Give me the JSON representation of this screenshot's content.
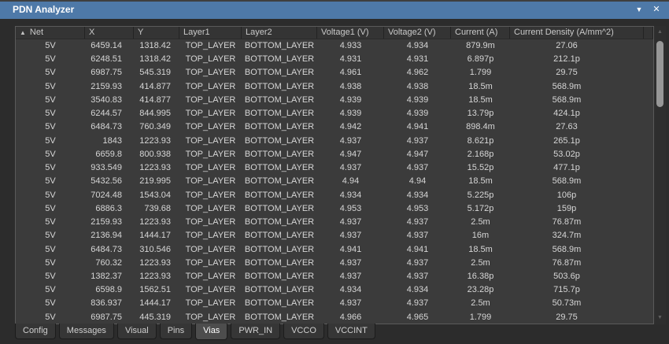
{
  "window": {
    "title": "PDN Analyzer"
  },
  "titlebar": {
    "menu_icon": "▼",
    "close_icon": "✕"
  },
  "table": {
    "sort_icon": "▲",
    "columns": [
      "Net",
      "X",
      "Y",
      "Layer1",
      "Layer2",
      "Voltage1 (V)",
      "Voltage2 (V)",
      "Current (A)",
      "Current Density (A/mm^2)"
    ],
    "rows": [
      [
        "5V",
        "6459.14",
        "1318.42",
        "TOP_LAYER",
        "BOTTOM_LAYER",
        "4.933",
        "4.934",
        "879.9m",
        "27.06"
      ],
      [
        "5V",
        "6248.51",
        "1318.42",
        "TOP_LAYER",
        "BOTTOM_LAYER",
        "4.931",
        "4.931",
        "6.897p",
        "212.1p"
      ],
      [
        "5V",
        "6987.75",
        "545.319",
        "TOP_LAYER",
        "BOTTOM_LAYER",
        "4.961",
        "4.962",
        "1.799",
        "29.75"
      ],
      [
        "5V",
        "2159.93",
        "414.877",
        "TOP_LAYER",
        "BOTTOM_LAYER",
        "4.938",
        "4.938",
        "18.5m",
        "568.9m"
      ],
      [
        "5V",
        "3540.83",
        "414.877",
        "TOP_LAYER",
        "BOTTOM_LAYER",
        "4.939",
        "4.939",
        "18.5m",
        "568.9m"
      ],
      [
        "5V",
        "6244.57",
        "844.995",
        "TOP_LAYER",
        "BOTTOM_LAYER",
        "4.939",
        "4.939",
        "13.79p",
        "424.1p"
      ],
      [
        "5V",
        "6484.73",
        "760.349",
        "TOP_LAYER",
        "BOTTOM_LAYER",
        "4.942",
        "4.941",
        "898.4m",
        "27.63"
      ],
      [
        "5V",
        "1843",
        "1223.93",
        "TOP_LAYER",
        "BOTTOM_LAYER",
        "4.937",
        "4.937",
        "8.621p",
        "265.1p"
      ],
      [
        "5V",
        "6659.8",
        "800.938",
        "TOP_LAYER",
        "BOTTOM_LAYER",
        "4.947",
        "4.947",
        "2.168p",
        "53.02p"
      ],
      [
        "5V",
        "933.549",
        "1223.93",
        "TOP_LAYER",
        "BOTTOM_LAYER",
        "4.937",
        "4.937",
        "15.52p",
        "477.1p"
      ],
      [
        "5V",
        "5432.56",
        "219.995",
        "TOP_LAYER",
        "BOTTOM_LAYER",
        "4.94",
        "4.94",
        "18.5m",
        "568.9m"
      ],
      [
        "5V",
        "7024.48",
        "1543.04",
        "TOP_LAYER",
        "BOTTOM_LAYER",
        "4.934",
        "4.934",
        "5.225p",
        "106p"
      ],
      [
        "5V",
        "6886.3",
        "739.68",
        "TOP_LAYER",
        "BOTTOM_LAYER",
        "4.953",
        "4.953",
        "5.172p",
        "159p"
      ],
      [
        "5V",
        "2159.93",
        "1223.93",
        "TOP_LAYER",
        "BOTTOM_LAYER",
        "4.937",
        "4.937",
        "2.5m",
        "76.87m"
      ],
      [
        "5V",
        "2136.94",
        "1444.17",
        "TOP_LAYER",
        "BOTTOM_LAYER",
        "4.937",
        "4.937",
        "16m",
        "324.7m"
      ],
      [
        "5V",
        "6484.73",
        "310.546",
        "TOP_LAYER",
        "BOTTOM_LAYER",
        "4.941",
        "4.941",
        "18.5m",
        "568.9m"
      ],
      [
        "5V",
        "760.32",
        "1223.93",
        "TOP_LAYER",
        "BOTTOM_LAYER",
        "4.937",
        "4.937",
        "2.5m",
        "76.87m"
      ],
      [
        "5V",
        "1382.37",
        "1223.93",
        "TOP_LAYER",
        "BOTTOM_LAYER",
        "4.937",
        "4.937",
        "16.38p",
        "503.6p"
      ],
      [
        "5V",
        "6598.9",
        "1562.51",
        "TOP_LAYER",
        "BOTTOM_LAYER",
        "4.934",
        "4.934",
        "23.28p",
        "715.7p"
      ],
      [
        "5V",
        "836.937",
        "1444.17",
        "TOP_LAYER",
        "BOTTOM_LAYER",
        "4.937",
        "4.937",
        "2.5m",
        "50.73m"
      ],
      [
        "5V",
        "6987.75",
        "445.319",
        "TOP_LAYER",
        "BOTTOM_LAYER",
        "4.966",
        "4.965",
        "1.799",
        "29.75"
      ]
    ]
  },
  "scrollbar": {
    "up_icon": "▲",
    "down_icon": "▼"
  },
  "tabs": [
    {
      "label": "Config",
      "active": false
    },
    {
      "label": "Messages",
      "active": false
    },
    {
      "label": "Visual",
      "active": false
    },
    {
      "label": "Pins",
      "active": false
    },
    {
      "label": "Vias",
      "active": true
    },
    {
      "label": "PWR_IN",
      "active": false
    },
    {
      "label": "VCCO",
      "active": false
    },
    {
      "label": "VCCINT",
      "active": false
    }
  ],
  "colors": {
    "titlebar": "#4e79a8",
    "panel_bg": "#2c2c2c",
    "grid_bg": "#3b3b3b",
    "header_bg": "#343434",
    "active_tab": "#4d4d4d"
  }
}
